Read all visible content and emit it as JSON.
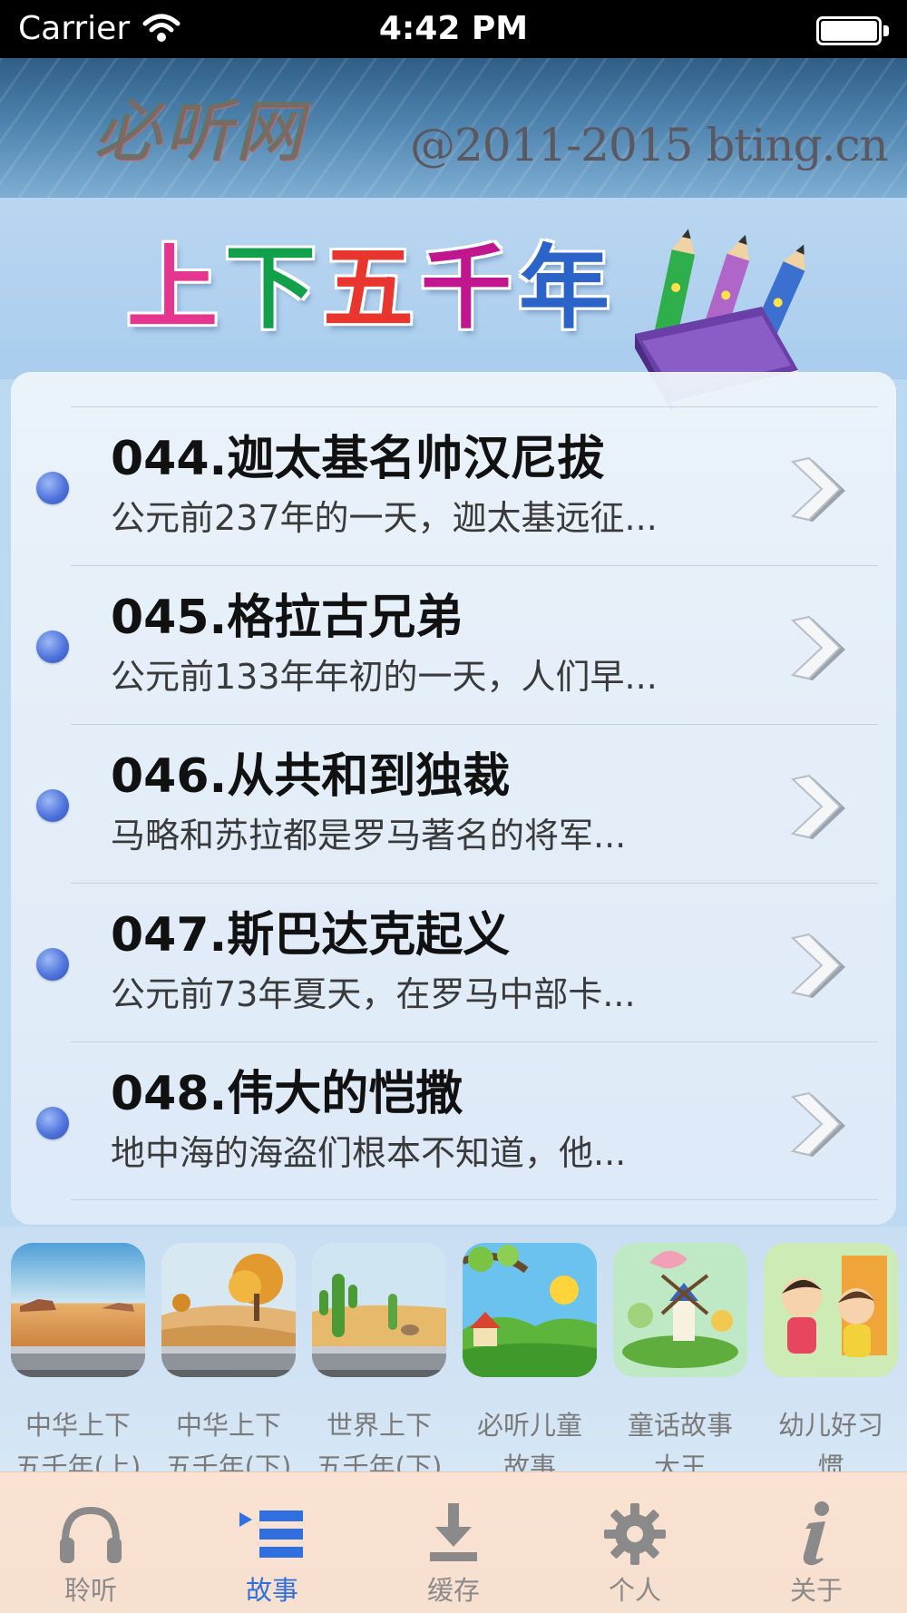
{
  "status_bar": {
    "carrier": "Carrier",
    "time": "4:42 PM"
  },
  "banner": {
    "logo": "必听网",
    "copyright": "@2011-2015 bting.cn"
  },
  "header": {
    "title_chars": [
      {
        "char": "上",
        "color": "#e5358f"
      },
      {
        "char": "下",
        "color": "#12a04a"
      },
      {
        "char": "五",
        "color": "#e8362e"
      },
      {
        "char": "千",
        "color": "#c1178e"
      },
      {
        "char": "年",
        "color": "#2b63c9"
      }
    ]
  },
  "list": {
    "items": [
      {
        "title": "044.迦太基名帅汉尼拔",
        "subtitle": "公元前237年的一天，迦太基远征..."
      },
      {
        "title": "045.格拉古兄弟",
        "subtitle": "公元前133年年初的一天，人们早..."
      },
      {
        "title": "046.从共和到独裁",
        "subtitle": "马略和苏拉都是罗马著名的将军..."
      },
      {
        "title": "047.斯巴达克起义",
        "subtitle": "公元前73年夏天，在罗马中部卡..."
      },
      {
        "title": "048.伟大的恺撒",
        "subtitle": "地中海的海盗们根本不知道，他..."
      }
    ]
  },
  "categories": {
    "items": [
      {
        "line1": "中华上下",
        "line2": "五千年(上)",
        "icon": "desert-canyon-icon"
      },
      {
        "line1": "中华上下",
        "line2": "五千年(下)",
        "icon": "autumn-dunes-icon"
      },
      {
        "line1": "世界上下",
        "line2": "五千年(下)",
        "icon": "cactus-desert-icon"
      },
      {
        "line1": "必听儿童",
        "line2": "故事",
        "icon": "cartoon-village-icon"
      },
      {
        "line1": "童话故事",
        "line2": "大王",
        "icon": "fairytale-windmill-icon"
      },
      {
        "line1": "幼儿好习",
        "line2": "惯",
        "icon": "kids-cartoon-icon"
      }
    ]
  },
  "tab_bar": {
    "active_color": "#2f6fe0",
    "inactive_color": "#8a8a8a",
    "tabs": [
      {
        "label": "聆听",
        "icon": "headphones-icon"
      },
      {
        "label": "故事",
        "icon": "story-list-icon",
        "active": true
      },
      {
        "label": "缓存",
        "icon": "download-icon"
      },
      {
        "label": "个人",
        "icon": "gear-icon"
      },
      {
        "label": "关于",
        "icon": "info-icon"
      }
    ]
  }
}
